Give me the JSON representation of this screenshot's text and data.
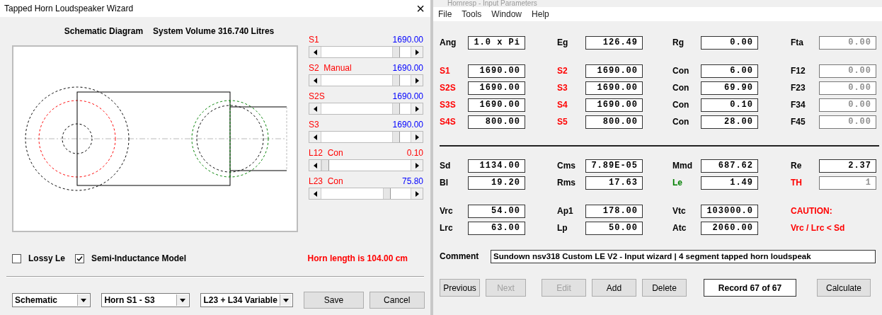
{
  "wizard": {
    "title": "Tapped Horn Loudspeaker Wizard",
    "close": "×",
    "heading": "Schematic Diagram",
    "volume": "System Volume 316.740 Litres",
    "sliders": [
      {
        "label": "S1",
        "value": "1690.00",
        "color": "#0000ff",
        "level": 0.87
      },
      {
        "label": "S2  Manual",
        "value": "1690.00",
        "color": "#0000ff",
        "level": 0.87
      },
      {
        "label": "S2S",
        "value": "1690.00",
        "color": "#0000ff",
        "level": 0.87
      },
      {
        "label": "S3",
        "value": "1690.00",
        "color": "#0000ff",
        "level": 0.87
      },
      {
        "label": "L12  Con",
        "value": "0.10",
        "color": "#ff0000",
        "level": 0
      },
      {
        "label": "L23  Con",
        "value": "75.80",
        "color": "#0000ff",
        "level": 0.76
      }
    ],
    "checkboxes": [
      {
        "label": "Lossy Le",
        "checked": false
      },
      {
        "label": "Semi-Inductance Model",
        "checked": true
      }
    ],
    "horn_length": "Horn length is 104.00 cm",
    "dropdowns": [
      {
        "value": "Schematic"
      },
      {
        "value": "Horn S1 - S3"
      },
      {
        "value": "L23 + L34 Variable"
      }
    ],
    "buttons": [
      "Save",
      "Cancel"
    ]
  },
  "main": {
    "title": "Hornresp - Input Parameters",
    "menu": [
      "File",
      "Tools",
      "Window",
      "Help"
    ],
    "sections": [
      {
        "rule_above": false,
        "rows": [
          [
            {
              "kind": "field",
              "label": "Ang",
              "color": "#000000",
              "value": "1.0 x Pi",
              "disabled": false
            },
            {
              "kind": "field",
              "label": "Eg",
              "color": "#000000",
              "value": "126.49",
              "disabled": false
            },
            {
              "kind": "field",
              "label": "Rg",
              "color": "#000000",
              "value": "0.00",
              "disabled": false
            },
            {
              "kind": "field",
              "label": "Fta",
              "color": "#000000",
              "value": "0.00",
              "disabled": true
            }
          ]
        ]
      },
      {
        "rule_above": false,
        "rows": [
          [
            {
              "kind": "field",
              "label": "S1",
              "color": "#ff0000",
              "value": "1690.00",
              "disabled": false
            },
            {
              "kind": "field",
              "label": "S2",
              "color": "#ff0000",
              "value": "1690.00",
              "disabled": false
            },
            {
              "kind": "field",
              "label": "Con",
              "color": "#000000",
              "value": "6.00",
              "disabled": false
            },
            {
              "kind": "field",
              "label": "F12",
              "color": "#000000",
              "value": "0.00",
              "disabled": true
            }
          ],
          [
            {
              "kind": "field",
              "label": "S2S",
              "color": "#ff0000",
              "value": "1690.00",
              "disabled": false
            },
            {
              "kind": "field",
              "label": "S3",
              "color": "#ff0000",
              "value": "1690.00",
              "disabled": false
            },
            {
              "kind": "field",
              "label": "Con",
              "color": "#000000",
              "value": "69.90",
              "disabled": false
            },
            {
              "kind": "field",
              "label": "F23",
              "color": "#000000",
              "value": "0.00",
              "disabled": true
            }
          ],
          [
            {
              "kind": "field",
              "label": "S3S",
              "color": "#ff0000",
              "value": "1690.00",
              "disabled": false
            },
            {
              "kind": "field",
              "label": "S4",
              "color": "#ff0000",
              "value": "1690.00",
              "disabled": false
            },
            {
              "kind": "field",
              "label": "Con",
              "color": "#000000",
              "value": "0.10",
              "disabled": false
            },
            {
              "kind": "field",
              "label": "F34",
              "color": "#000000",
              "value": "0.00",
              "disabled": true
            }
          ],
          [
            {
              "kind": "field",
              "label": "S4S",
              "color": "#ff0000",
              "value": "800.00",
              "disabled": false
            },
            {
              "kind": "field",
              "label": "S5",
              "color": "#ff0000",
              "value": "800.00",
              "disabled": false
            },
            {
              "kind": "field",
              "label": "Con",
              "color": "#000000",
              "value": "28.00",
              "disabled": false
            },
            {
              "kind": "field",
              "label": "F45",
              "color": "#000000",
              "value": "0.00",
              "disabled": true
            }
          ]
        ]
      },
      {
        "rule_above": true,
        "rows": [
          [
            {
              "kind": "field",
              "label": "Sd",
              "color": "#000000",
              "value": "1134.00",
              "disabled": false
            },
            {
              "kind": "field",
              "label": "Cms",
              "color": "#000000",
              "value": "7.89E-05",
              "disabled": false
            },
            {
              "kind": "field",
              "label": "Mmd",
              "color": "#000000",
              "value": "687.62",
              "disabled": false
            },
            {
              "kind": "field",
              "label": "Re",
              "color": "#000000",
              "value": "2.37",
              "disabled": false
            }
          ],
          [
            {
              "kind": "field",
              "label": "Bl",
              "color": "#000000",
              "value": "19.20",
              "disabled": false
            },
            {
              "kind": "field",
              "label": "Rms",
              "color": "#000000",
              "value": "17.63",
              "disabled": false
            },
            {
              "kind": "field",
              "label": "Le",
              "color": "#008000",
              "value": "1.49",
              "disabled": false
            },
            {
              "kind": "field",
              "label": "TH",
              "color": "#ff0000",
              "value": "1",
              "disabled": true
            }
          ]
        ]
      },
      {
        "rule_above": false,
        "rows": [
          [
            {
              "kind": "field",
              "label": "Vrc",
              "color": "#000000",
              "value": "54.00",
              "disabled": false
            },
            {
              "kind": "field",
              "label": "Ap1",
              "color": "#000000",
              "value": "178.00",
              "disabled": false
            },
            {
              "kind": "field",
              "label": "Vtc",
              "color": "#000000",
              "value": "103000.0",
              "disabled": false
            },
            {
              "kind": "note",
              "text": "CAUTION:",
              "color": "#ff0000"
            }
          ],
          [
            {
              "kind": "field",
              "label": "Lrc",
              "color": "#000000",
              "value": "63.00",
              "disabled": false
            },
            {
              "kind": "field",
              "label": "Lp",
              "color": "#000000",
              "value": "50.00",
              "disabled": false
            },
            {
              "kind": "field",
              "label": "Atc",
              "color": "#000000",
              "value": "2060.00",
              "disabled": false
            },
            {
              "kind": "note",
              "text": "Vrc / Lrc < Sd",
              "color": "#ff0000"
            }
          ]
        ]
      }
    ],
    "comment": {
      "label": "Comment",
      "value": "Sundown nsv318 Custom LE V2 - Input wizard | 4 segment tapped horn loudspeak"
    },
    "buttons": [
      {
        "kind": "button",
        "label": "Previous",
        "disabled": false
      },
      {
        "kind": "button",
        "label": "Next",
        "disabled": true
      },
      {
        "kind": "button",
        "label": "Edit",
        "disabled": true
      },
      {
        "kind": "button",
        "label": "Add",
        "disabled": false
      },
      {
        "kind": "button",
        "label": "Delete",
        "disabled": false
      },
      {
        "kind": "record",
        "label": "Record 67 of 67"
      },
      {
        "kind": "button",
        "label": "Calculate",
        "disabled": false
      }
    ]
  }
}
